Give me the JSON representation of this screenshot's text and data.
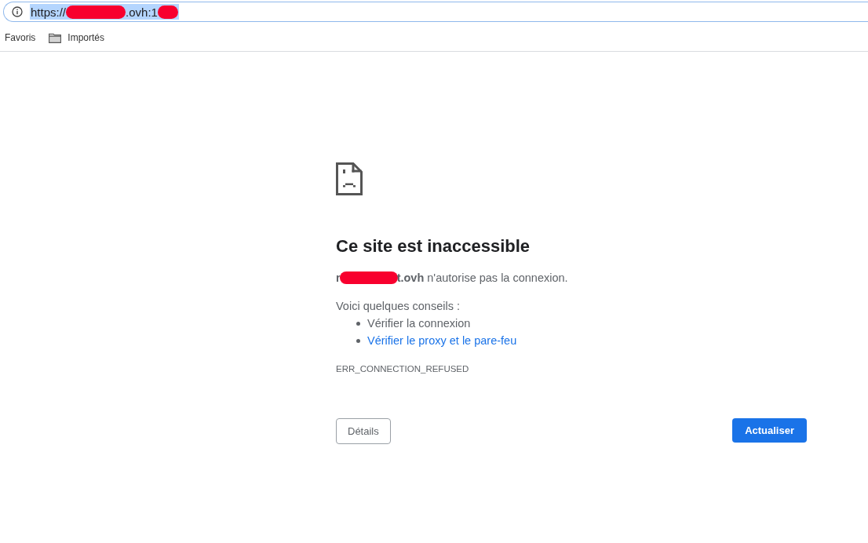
{
  "address_bar": {
    "selected": true,
    "url_parts": [
      {
        "kind": "text",
        "text": "https://"
      },
      {
        "kind": "redacted"
      },
      {
        "kind": "text",
        "text": ".ovh:1"
      },
      {
        "kind": "redacted"
      }
    ]
  },
  "bookmarks": [
    {
      "kind": "plain",
      "label": "Favoris"
    },
    {
      "kind": "folder",
      "label": "Importés"
    }
  ],
  "error": {
    "title": "Ce site est inaccessible",
    "host_parts": [
      {
        "kind": "text",
        "text": "r"
      },
      {
        "kind": "redacted"
      },
      {
        "kind": "text",
        "text": "t.ovh"
      }
    ],
    "message": "n'autorise pas la connexion.",
    "tips_heading": "Voici quelques conseils :",
    "tips": [
      {
        "kind": "text",
        "text": "Vérifier la connexion"
      },
      {
        "kind": "link",
        "text": "Vérifier le proxy et le pare-feu"
      }
    ],
    "code": "ERR_CONNECTION_REFUSED"
  },
  "buttons": [
    {
      "kind": "secondary",
      "label": "Détails"
    },
    {
      "kind": "primary",
      "label": "Actualiser"
    }
  ]
}
